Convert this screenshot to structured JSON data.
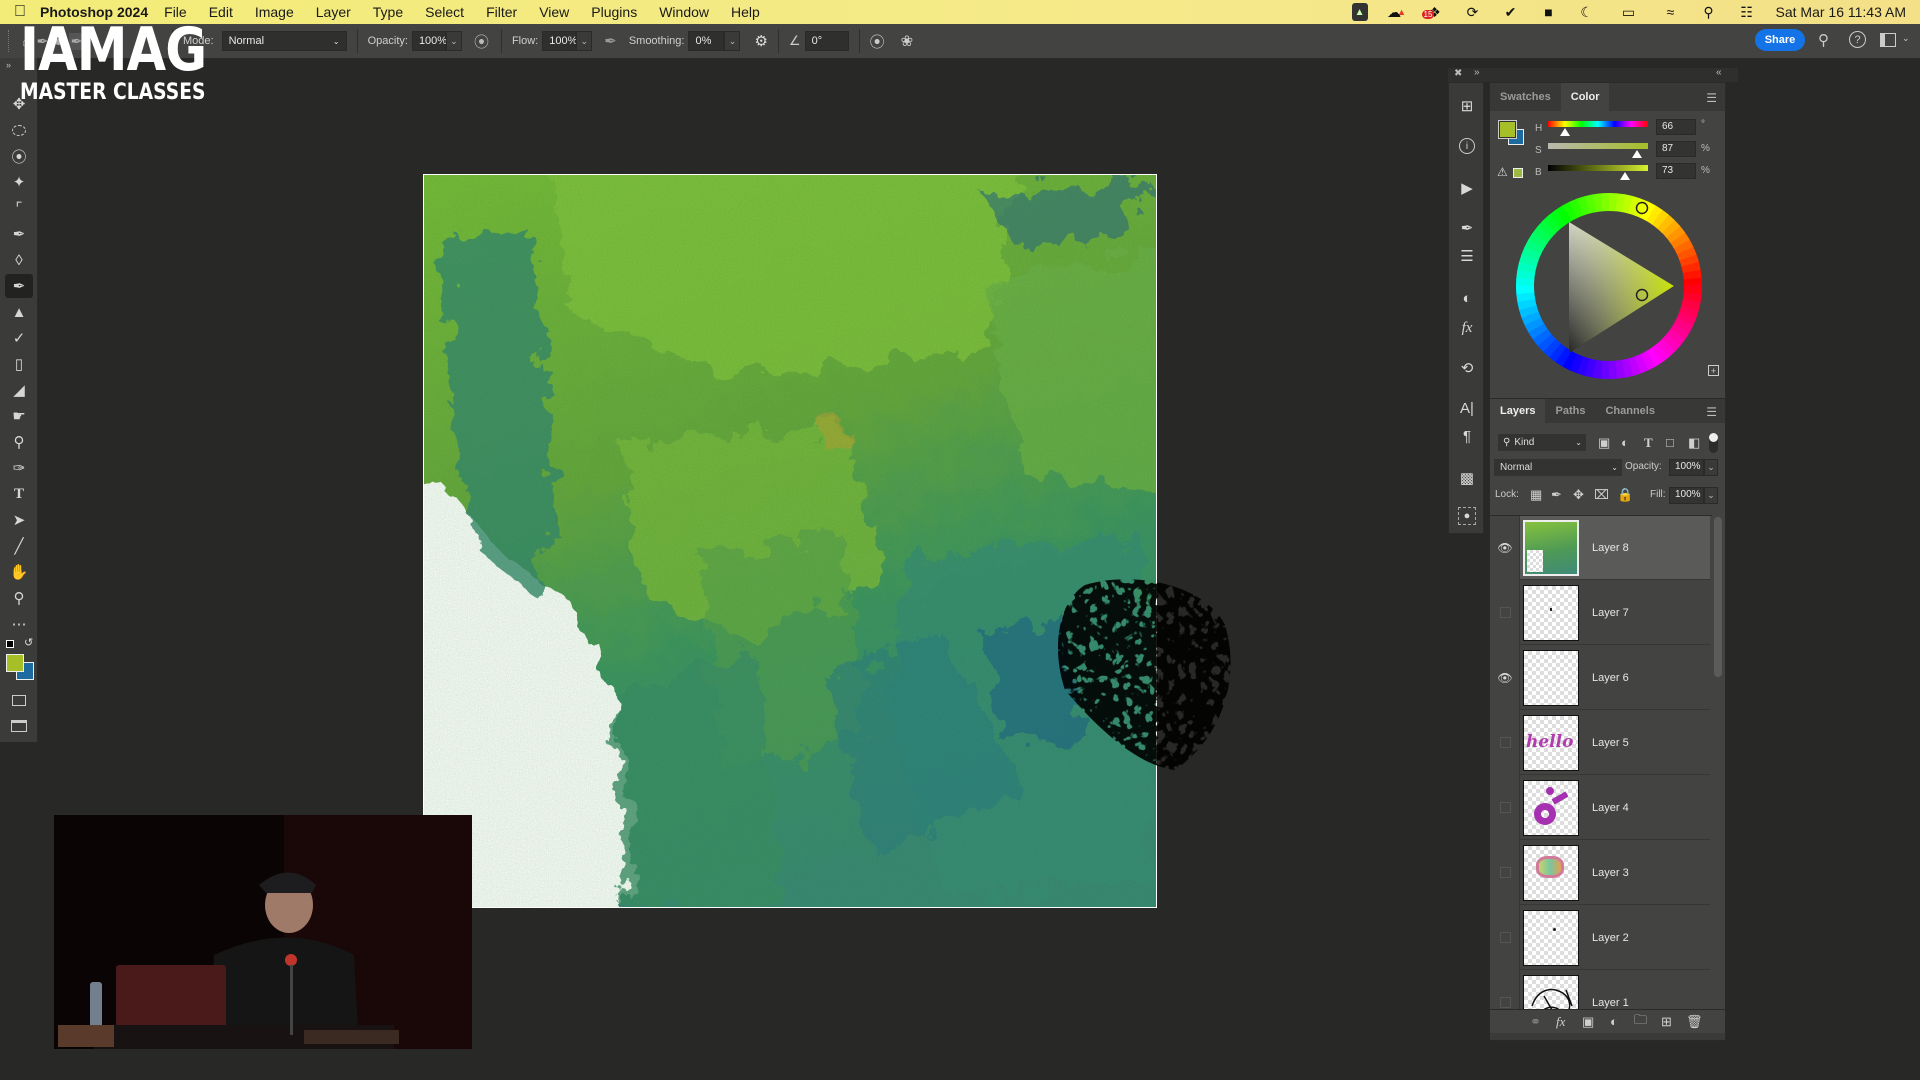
{
  "menubar": {
    "app_name": "Photoshop 2024",
    "menus": [
      "File",
      "Edit",
      "Image",
      "Layer",
      "Type",
      "Select",
      "Filter",
      "View",
      "Plugins",
      "Window",
      "Help"
    ],
    "status_icons": [
      "app-icon",
      "creative-cloud-icon",
      "dropbox-icon",
      "sync-icon",
      "checkmark-icon",
      "notification-icon",
      "do-not-disturb-icon",
      "battery-icon",
      "wifi-icon",
      "spotlight-icon",
      "control-center-icon"
    ],
    "dropbox_badge": "15",
    "datetime": "Sat Mar 16  11:43 AM"
  },
  "options_bar": {
    "mode_label": "Mode:",
    "mode_value": "Normal",
    "opacity_label": "Opacity:",
    "opacity_value": "100%",
    "flow_label": "Flow:",
    "flow_value": "100%",
    "smoothing_label": "Smoothing:",
    "smoothing_value": "0%",
    "angle_value": "0°",
    "share_label": "Share"
  },
  "overlay": {
    "logo_line1": "IAMAG",
    "logo_line2": "MASTER CLASSES"
  },
  "tools": [
    "move",
    "rectangular-marquee",
    "lasso",
    "magic-wand",
    "crop",
    "eyedropper",
    "spot-healing",
    "brush",
    "clone-stamp",
    "history-brush",
    "eraser",
    "paint-bucket",
    "smudge",
    "dodge",
    "pen",
    "type",
    "path-selection",
    "line",
    "hand-rotate",
    "zoom",
    "more"
  ],
  "active_tool": "brush",
  "colors": {
    "foreground": "#a6bf26",
    "background": "#1c6aa0",
    "accent": "#1473e6",
    "menubar": "#f3ec78"
  },
  "color_panel": {
    "tabs": [
      "Swatches",
      "Color"
    ],
    "active_tab": "Color",
    "h_label": "H",
    "s_label": "S",
    "b_label": "B",
    "h_value": "66",
    "s_value": "87",
    "b_value": "73",
    "h_unit": "°",
    "s_unit": "%",
    "b_unit": "%"
  },
  "layers_panel": {
    "tabs": [
      "Layers",
      "Paths",
      "Channels"
    ],
    "active_tab": "Layers",
    "filter_label": "Kind",
    "blend_mode": "Normal",
    "opacity_label": "Opacity:",
    "opacity_value": "100%",
    "lock_label": "Lock:",
    "fill_label": "Fill:",
    "fill_value": "100%",
    "layers": [
      {
        "name": "Layer 8",
        "visible": true,
        "selected": true
      },
      {
        "name": "Layer 7",
        "visible": false,
        "selected": false
      },
      {
        "name": "Layer 6",
        "visible": true,
        "selected": false
      },
      {
        "name": "Layer 5",
        "visible": false,
        "selected": false
      },
      {
        "name": "Layer 4",
        "visible": false,
        "selected": false
      },
      {
        "name": "Layer 3",
        "visible": false,
        "selected": false
      },
      {
        "name": "Layer 2",
        "visible": false,
        "selected": false
      },
      {
        "name": "Layer 1",
        "visible": false,
        "selected": false
      }
    ],
    "thumb_5_text": "hello"
  }
}
